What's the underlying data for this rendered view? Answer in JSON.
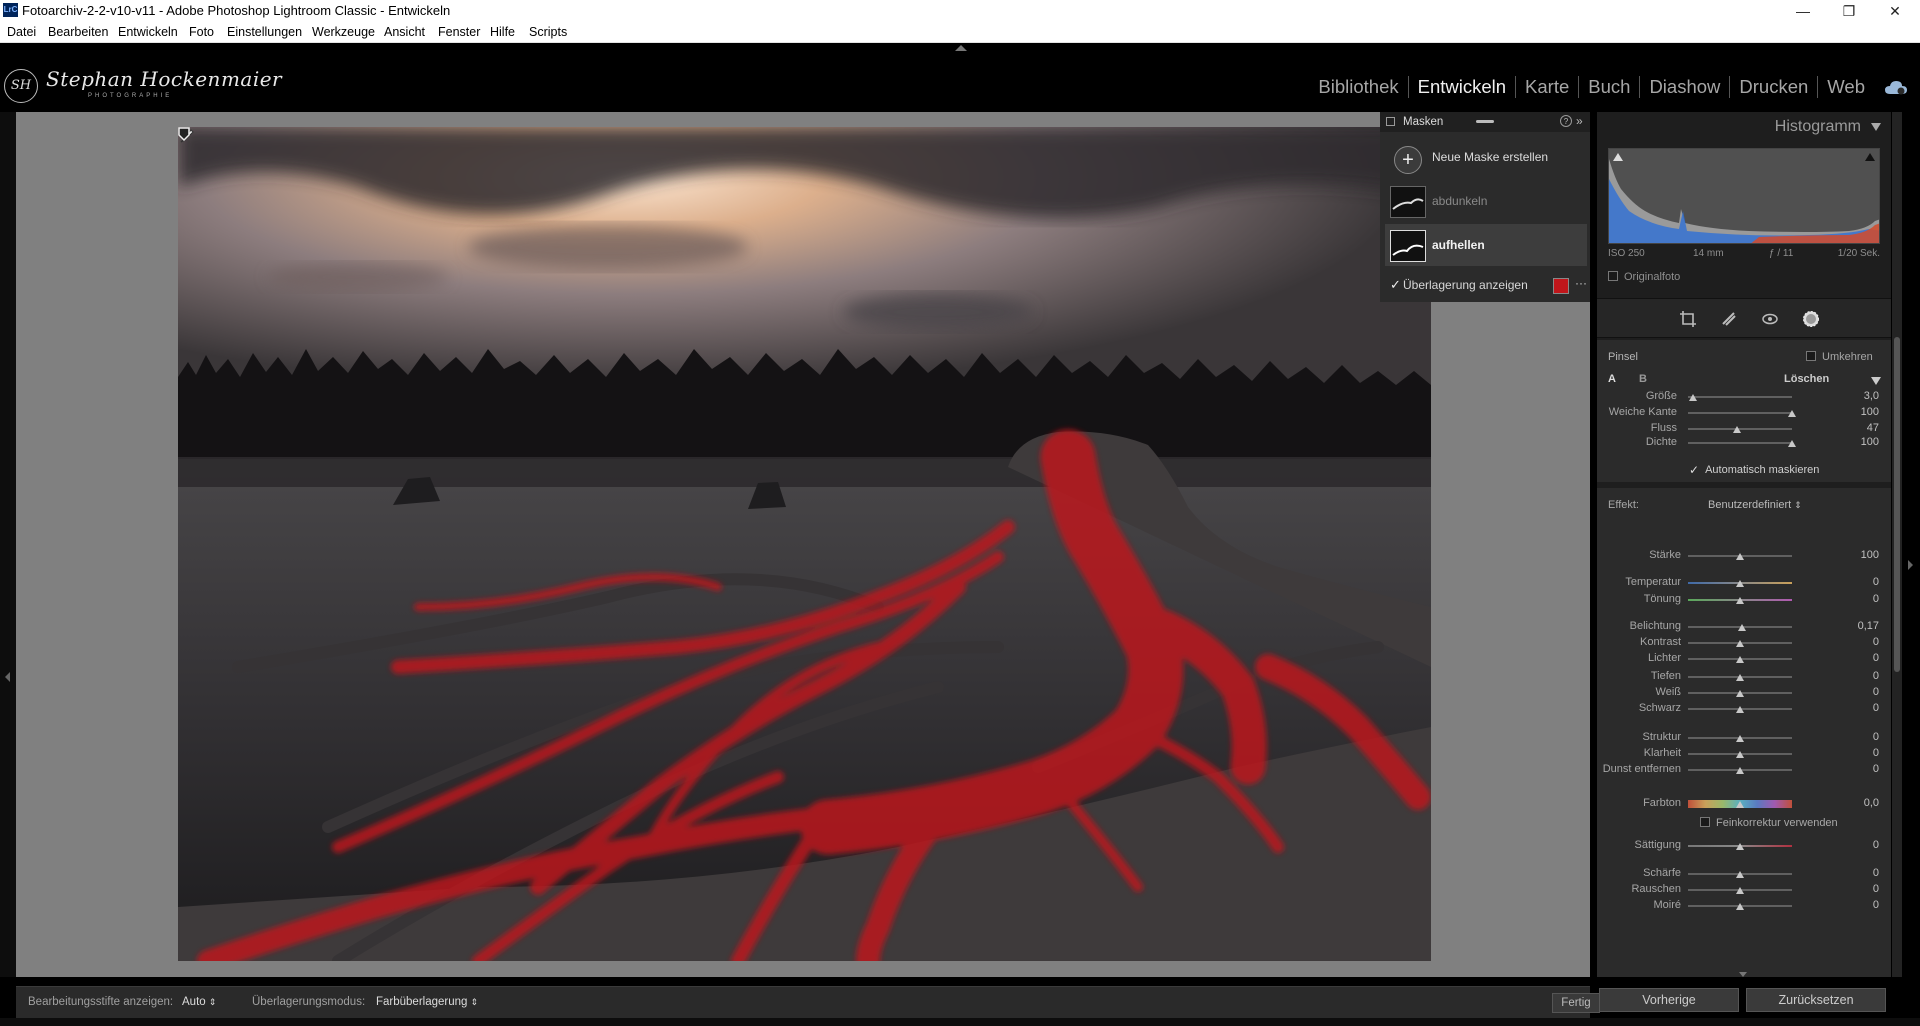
{
  "window": {
    "app_icon": "LrC",
    "title": "Fotoarchiv-2-2-v10-v11 - Adobe Photoshop Lightroom Classic - Entwickeln",
    "minimize_icon": "minimize-icon",
    "maximize_icon": "restore-icon",
    "close_icon": "close-icon"
  },
  "menu": [
    "Datei",
    "Bearbeiten",
    "Entwickeln",
    "Foto",
    "Einstellungen",
    "Werkzeuge",
    "Ansicht",
    "Fenster",
    "Hilfe",
    "Scripts"
  ],
  "identity": {
    "monogram": "SH",
    "name": "Stephan Hockenmaier",
    "subtitle": "PHOTOGRAPHIE"
  },
  "modules": [
    "Bibliothek",
    "Entwickeln",
    "Karte",
    "Buch",
    "Diashow",
    "Drucken",
    "Web"
  ],
  "active_module": "Entwickeln",
  "masks_panel": {
    "title": "Masken",
    "new_mask": "Neue Maske erstellen",
    "masks": [
      "abdunkeln",
      "aufhellen"
    ],
    "selected_mask": "aufhellen",
    "overlay_label": "Überlagerung anzeigen",
    "overlay_checked": true,
    "overlay_color": "#c0161b",
    "more": "···"
  },
  "histogram": {
    "title": "Histogramm",
    "iso": "ISO 250",
    "focal": "14 mm",
    "aperture": "ƒ / 11",
    "shutter": "1/20 Sek.",
    "original_label": "Originalfoto"
  },
  "tools": [
    "crop-icon",
    "heal-icon",
    "redeye-icon",
    "mask-icon"
  ],
  "brush": {
    "title": "Pinsel",
    "invert_label": "Umkehren",
    "tab_a": "A",
    "tab_b": "B",
    "erase_label": "Löschen",
    "sliders": [
      {
        "label": "Größe",
        "value": "3,0",
        "pos": 0.05
      },
      {
        "label": "Weiche Kante",
        "value": "100",
        "pos": 1.0
      },
      {
        "label": "Fluss",
        "value": "47",
        "pos": 0.47
      },
      {
        "label": "Dichte",
        "value": "100",
        "pos": 1.0
      }
    ],
    "auto_mask_label": "Automatisch maskieren",
    "auto_mask_checked": true
  },
  "effect": {
    "label": "Effekt:",
    "preset": "Benutzerdefiniert",
    "sliders": [
      {
        "label": "Stärke",
        "value": "100",
        "pos": 0.5
      },
      {
        "label": "Temperatur",
        "value": "0",
        "pos": 0.5
      },
      {
        "label": "Tönung",
        "value": "0",
        "pos": 0.5
      },
      {
        "label": "Belichtung",
        "value": "0,17",
        "pos": 0.52
      },
      {
        "label": "Kontrast",
        "value": "0",
        "pos": 0.5
      },
      {
        "label": "Lichter",
        "value": "0",
        "pos": 0.5
      },
      {
        "label": "Tiefen",
        "value": "0",
        "pos": 0.5
      },
      {
        "label": "Weiß",
        "value": "0",
        "pos": 0.5
      },
      {
        "label": "Schwarz",
        "value": "0",
        "pos": 0.5
      },
      {
        "label": "Struktur",
        "value": "0",
        "pos": 0.5
      },
      {
        "label": "Klarheit",
        "value": "0",
        "pos": 0.5
      },
      {
        "label": "Dunst entfernen",
        "value": "0",
        "pos": 0.5
      },
      {
        "label": "Farbton",
        "value": "0,0",
        "pos": 0.5
      },
      {
        "label": "Sättigung",
        "value": "0",
        "pos": 0.5
      },
      {
        "label": "Schärfe",
        "value": "0",
        "pos": 0.5
      },
      {
        "label": "Rauschen",
        "value": "0",
        "pos": 0.5
      },
      {
        "label": "Moiré",
        "value": "0",
        "pos": 0.5
      }
    ],
    "fine_label": "Feinkorrektur verwenden"
  },
  "toolbar": {
    "pins_label": "Bearbeitungsstifte anzeigen:",
    "pins_value": "Auto",
    "overlay_mode_label": "Überlagerungsmodus:",
    "overlay_mode_value": "Farbüberlagerung",
    "done": "Fertig"
  },
  "panel_buttons": {
    "previous": "Vorherige",
    "reset": "Zurücksetzen"
  }
}
